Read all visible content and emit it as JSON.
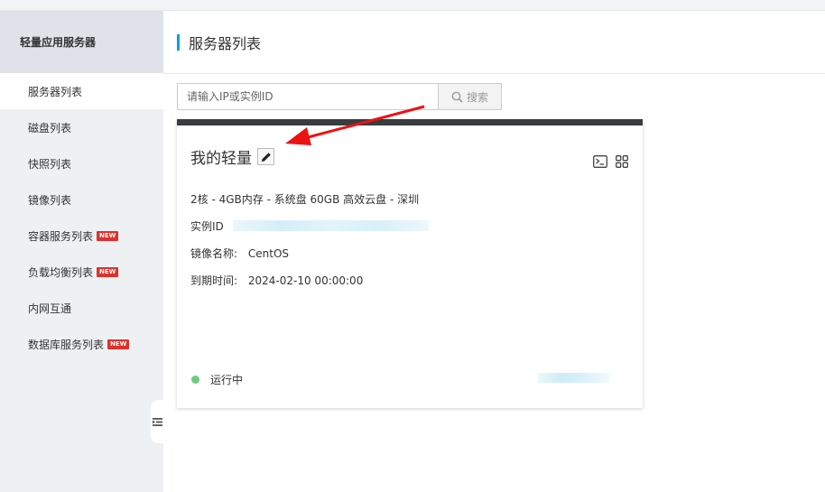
{
  "sidebar": {
    "title": "轻量应用服务器",
    "items": [
      {
        "label": "服务器列表",
        "active": true,
        "badge": ""
      },
      {
        "label": "磁盘列表",
        "active": false,
        "badge": ""
      },
      {
        "label": "快照列表",
        "active": false,
        "badge": ""
      },
      {
        "label": "镜像列表",
        "active": false,
        "badge": ""
      },
      {
        "label": "容器服务列表",
        "active": false,
        "badge": "NEW"
      },
      {
        "label": "负载均衡列表",
        "active": false,
        "badge": "NEW"
      },
      {
        "label": "内网互通",
        "active": false,
        "badge": ""
      },
      {
        "label": "数据库服务列表",
        "active": false,
        "badge": "NEW"
      }
    ],
    "collapse_icon": "collapse-menu-icon"
  },
  "header": {
    "title": "服务器列表",
    "accent_color": "#00a3d9"
  },
  "search": {
    "placeholder": "请输入IP或实例ID",
    "value": "",
    "button_label": "搜索"
  },
  "server_card": {
    "name": "我的轻量",
    "spec": "2核 - 4GB内存 - 系统盘 60GB 高效云盘 - 深圳",
    "instance_id_label": "实例ID",
    "image_label": "镜像名称:",
    "image_value": "CentOS",
    "expiry_label": "到期时间:",
    "expiry_value": "2024-02-10 00:00:00",
    "status": "运行中",
    "status_color": "#6dcb7c",
    "header_color": "#373d41",
    "icons": [
      "terminal-icon",
      "grid-icon"
    ]
  },
  "annotation": {
    "arrow_color": "#ee1111"
  }
}
